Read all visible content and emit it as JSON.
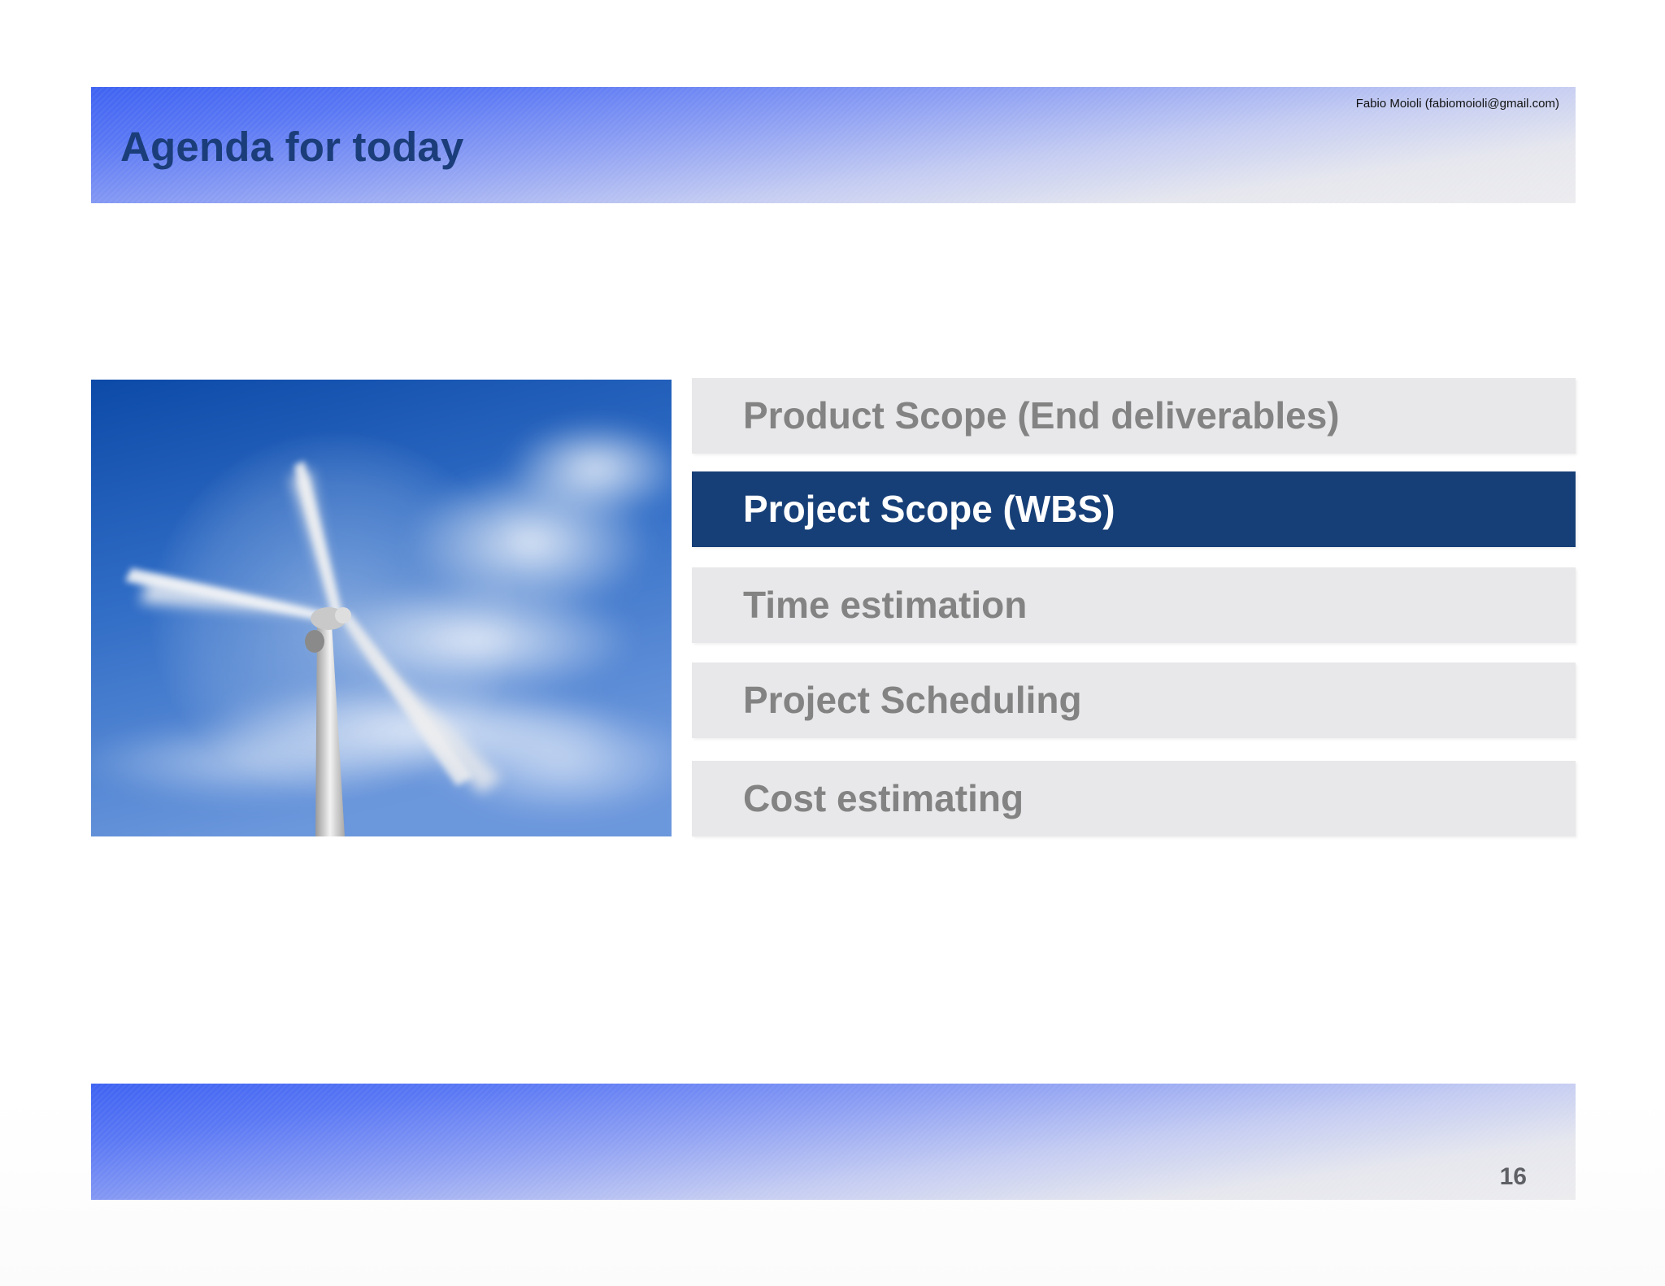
{
  "header": {
    "title": "Agenda for today",
    "author": "Fabio Moioli (fabiomoioli@gmail.com)"
  },
  "image": {
    "subject": "wind-turbine-photo"
  },
  "agenda": {
    "items": [
      {
        "label": "Product Scope (End deliverables)",
        "active": false
      },
      {
        "label": "Project Scope (WBS)",
        "active": true
      },
      {
        "label": "Time estimation",
        "active": false
      },
      {
        "label": "Project Scheduling",
        "active": false
      },
      {
        "label": "Cost estimating",
        "active": false
      }
    ]
  },
  "footer": {
    "page_number": "16"
  },
  "colors": {
    "title": "#1b3d7a",
    "active_item": "#173f77",
    "inactive_item": "#e8e8ea",
    "inactive_text": "#838383",
    "band_start": "#3f63f2",
    "band_end": "#ececef"
  }
}
